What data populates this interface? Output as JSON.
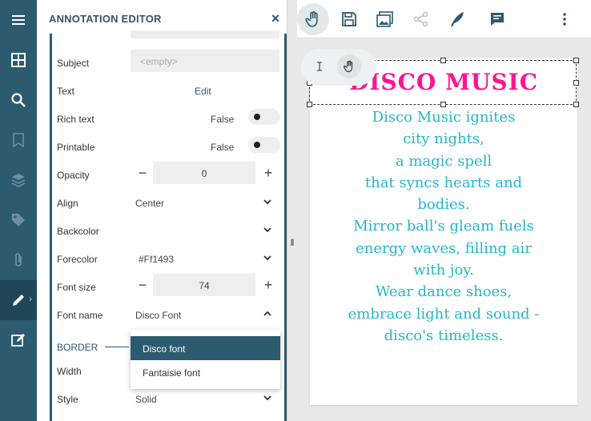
{
  "panel": {
    "title": "ANNOTATION EDITOR",
    "close_symbol": "×"
  },
  "rail": {
    "icons": [
      "menu-icon",
      "thumbnails-icon",
      "search-icon",
      "bookmark-icon",
      "layers-icon",
      "tag-icon",
      "attachment-icon",
      "pencil-icon",
      "edit-annotation-icon"
    ]
  },
  "properties": {
    "subject": {
      "label": "Subject",
      "placeholder": "<empty>"
    },
    "text": {
      "label": "Text",
      "value": "Edit"
    },
    "rich_text": {
      "label": "Rich text",
      "value": "False"
    },
    "printable": {
      "label": "Printable",
      "value": "False"
    },
    "opacity": {
      "label": "Opacity",
      "value": "0",
      "minus": "−",
      "plus": "+"
    },
    "align": {
      "label": "Align",
      "value": "Center"
    },
    "backcolor": {
      "label": "Backcolor"
    },
    "forecolor": {
      "label": "Forecolor",
      "value": "#Ff1493"
    },
    "font_size": {
      "label": "Font size",
      "value": "74",
      "minus": "−",
      "plus": "+"
    },
    "font_name": {
      "label": "Font name",
      "value": "Disco Font"
    },
    "border_section": "BORDER",
    "width": {
      "label": "Width"
    },
    "style": {
      "label": "Style",
      "value": "Solid"
    }
  },
  "font_dropdown": {
    "options": [
      "Disco font",
      "Fantaisie font"
    ]
  },
  "splitter": "‖",
  "toolbar": {
    "buttons": [
      "pan-icon",
      "save-icon",
      "image-icon",
      "share-icon",
      "signature-icon",
      "comment-icon",
      "more-icon"
    ]
  },
  "mini_tools": [
    "text-cursor-icon",
    "hand-icon"
  ],
  "document": {
    "title": "DISCO MUSIC",
    "lines": [
      "Disco Music ignites",
      "city nights,",
      "a magic spell",
      "that syncs hearts and",
      "bodies.",
      "Mirror ball's gleam fuels",
      "energy waves, filling air",
      "with joy.",
      "Wear dance shoes,",
      "embrace light and sound -",
      "disco's timeless."
    ]
  },
  "colors": {
    "sidebar": "#2c5a6e",
    "forecolor": "#ff1493",
    "body_text": "#25b6c9"
  }
}
